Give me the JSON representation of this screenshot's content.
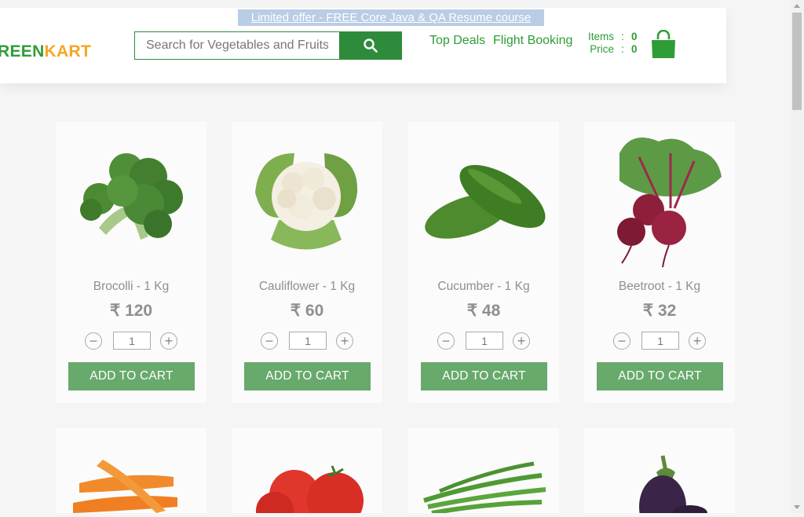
{
  "offer": "Limited offer - FREE Core Java & QA Resume course",
  "logo": {
    "green": "REEN",
    "orange": "KART"
  },
  "search": {
    "placeholder": "Search for Vegetables and Fruits"
  },
  "nav": {
    "top_deals": "Top Deals",
    "flight_booking": "Flight Booking"
  },
  "cart": {
    "items_label": "Items",
    "items_value": "0",
    "price_label": "Price",
    "price_value": "0",
    "colon": ":"
  },
  "products": [
    {
      "name": "Brocolli - 1 Kg",
      "price": "₹ 120",
      "qty": "1",
      "button": "ADD TO CART"
    },
    {
      "name": "Cauliflower - 1 Kg",
      "price": "₹ 60",
      "qty": "1",
      "button": "ADD TO CART"
    },
    {
      "name": "Cucumber - 1 Kg",
      "price": "₹ 48",
      "qty": "1",
      "button": "ADD TO CART"
    },
    {
      "name": "Beetroot - 1 Kg",
      "price": "₹ 32",
      "qty": "1",
      "button": "ADD TO CART"
    }
  ],
  "qty_controls": {
    "minus": "−",
    "plus": "+"
  },
  "colors": {
    "brand_green": "#2e8b3b",
    "brand_orange": "#f6a623",
    "button_green": "#68a96c"
  }
}
